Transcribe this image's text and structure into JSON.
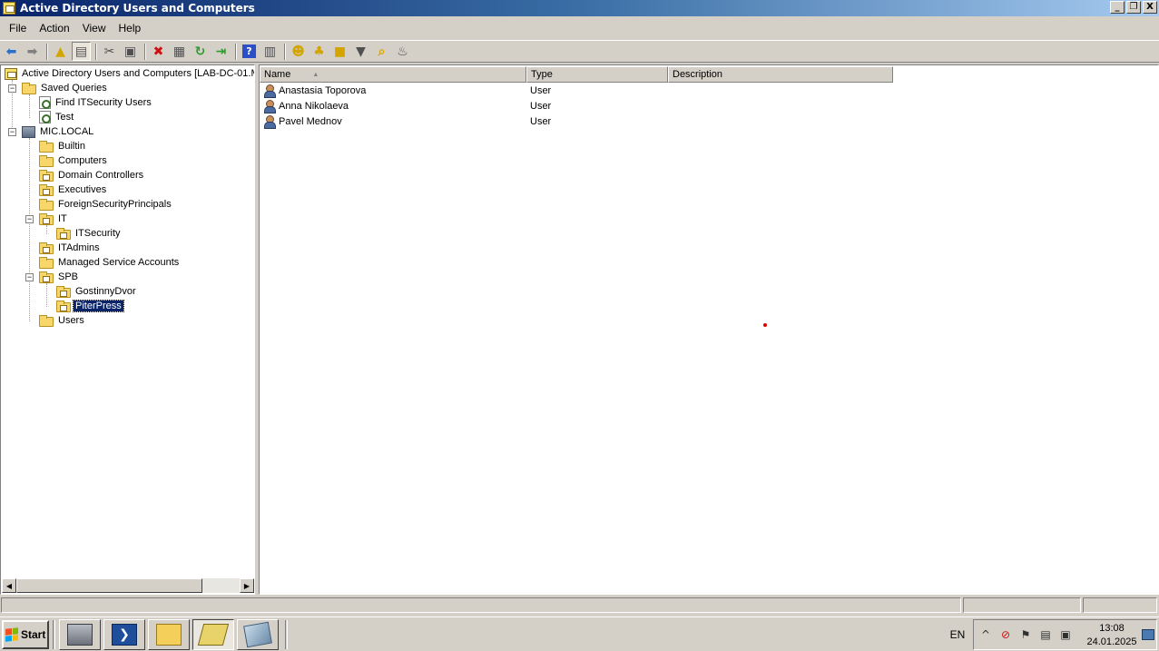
{
  "window": {
    "title": "Active Directory Users and Computers",
    "controls": [
      "_",
      "❐",
      "X"
    ]
  },
  "menu": [
    "File",
    "Action",
    "View",
    "Help"
  ],
  "toolbar": {
    "icons": [
      "back-icon",
      "forward-icon",
      "up-folder-icon",
      "show-console-tree-icon",
      "cut-icon",
      "paste-icon",
      "delete-icon",
      "properties-icon",
      "refresh-icon",
      "export-list-icon",
      "help-icon",
      "show-action-pane-icon",
      "new-user-icon",
      "new-group-icon",
      "new-ou-icon",
      "filter-icon",
      "find-icon",
      "add-to-group-icon"
    ]
  },
  "tree": {
    "root": "Active Directory Users and Computers [LAB-DC-01.M",
    "saved_queries": "Saved Queries",
    "queries": [
      "Find ITSecurity Users",
      "Test"
    ],
    "domain": "MIC.LOCAL",
    "containers": {
      "builtin": "Builtin",
      "computers": "Computers",
      "domain_controllers": "Domain Controllers",
      "executives": "Executives",
      "foreign": "ForeignSecurityPrincipals",
      "it": "IT",
      "itsecurity": "ITSecurity",
      "itadmins": "ITAdmins",
      "managed": "Managed Service Accounts",
      "spb": "SPB",
      "gostinny": "GostinnyDvor",
      "piterpress": "PiterPress",
      "users": "Users"
    },
    "selected": "PiterPress"
  },
  "list": {
    "columns": [
      "Name",
      "Type",
      "Description"
    ],
    "sorted_column": "Name",
    "rows": [
      {
        "name": "Anastasia Toporova",
        "type": "User",
        "description": ""
      },
      {
        "name": "Anna Nikolaeva",
        "type": "User",
        "description": ""
      },
      {
        "name": "Pavel Mednov",
        "type": "User",
        "description": ""
      }
    ]
  },
  "taskbar": {
    "start": "Start",
    "apps": [
      "server-manager-icon",
      "powershell-icon",
      "windows-explorer-icon",
      "aduc-icon",
      "notepad-icon"
    ],
    "active_app": "aduc-icon",
    "language": "EN",
    "time": "13:08",
    "date": "24.01.2025"
  }
}
